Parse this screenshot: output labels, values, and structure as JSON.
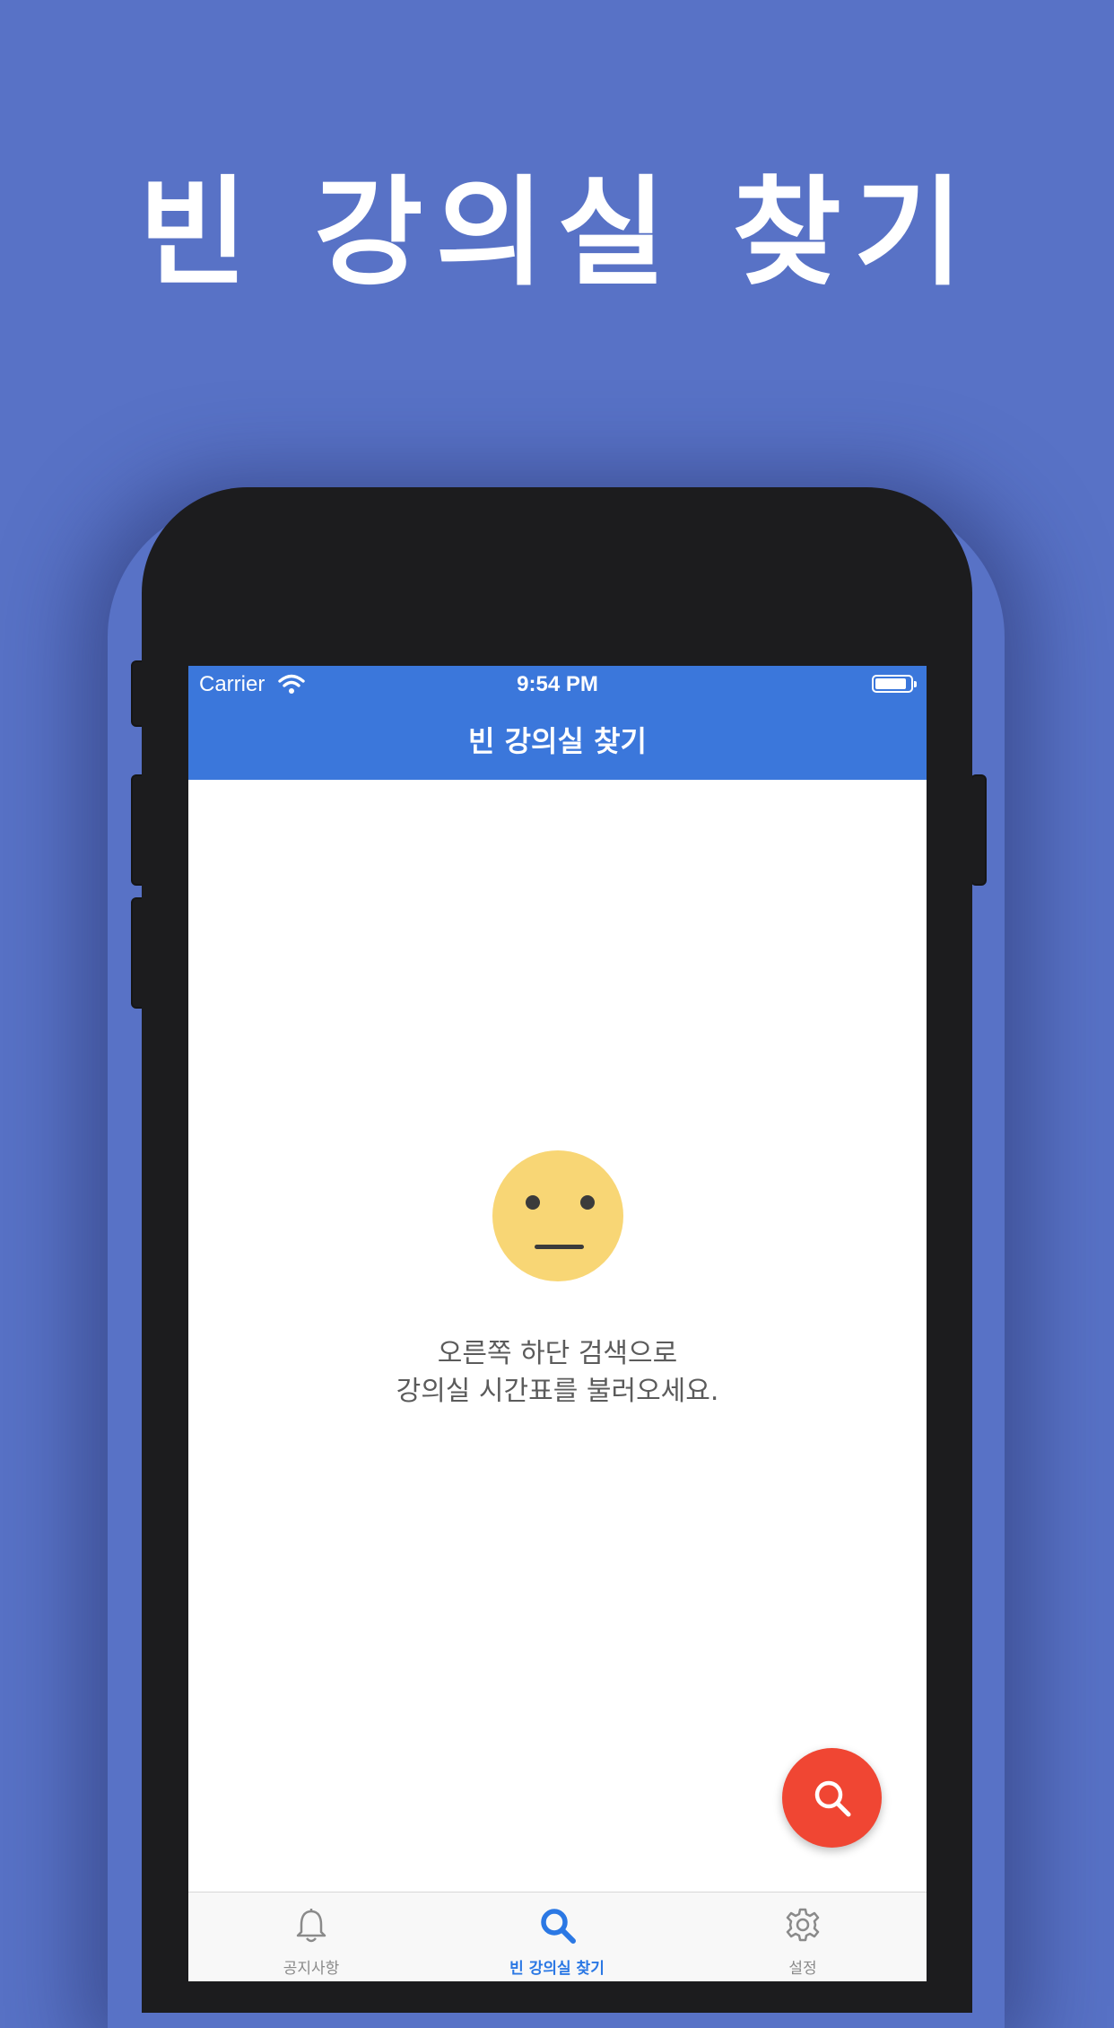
{
  "headline": "빈 강의실 찾기",
  "status_bar": {
    "carrier": "Carrier",
    "time": "9:54 PM"
  },
  "app_bar": {
    "title": "빈 강의실 찾기"
  },
  "empty_state": {
    "icon": "neutral-face-icon",
    "line1": "오른쪽 하단 검색으로",
    "line2": "강의실 시간표를 불러오세요."
  },
  "fab": {
    "icon": "search-icon"
  },
  "tabs": [
    {
      "label": "공지사항",
      "icon": "bell-icon",
      "active": false
    },
    {
      "label": "빈 강의실 찾기",
      "icon": "search-icon",
      "active": true
    },
    {
      "label": "설정",
      "icon": "gear-icon",
      "active": false
    }
  ],
  "colors": {
    "background": "#5872c6",
    "app_bar": "#3b77db",
    "fab": "#f04633",
    "tab_active": "#2b78e4",
    "tab_inactive": "#8a8a8a",
    "face": "#f8d675"
  }
}
